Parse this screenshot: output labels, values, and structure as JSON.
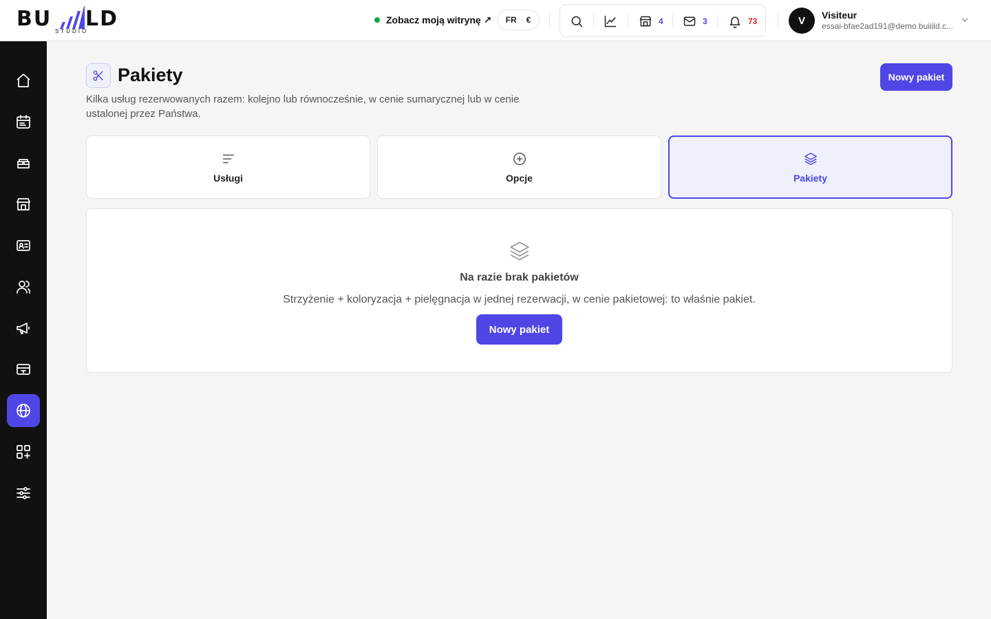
{
  "brand": {
    "logo_left": "BU",
    "logo_right": "LD",
    "logo_sub": "STUDIO",
    "accent": "#4f46e5"
  },
  "topbar": {
    "site_link": "Zobacz moją witrynę ↗",
    "site_status_color": "#16a34a",
    "lang": "FR",
    "currency": "€",
    "tools": [
      {
        "icon": "search-icon"
      },
      {
        "icon": "chart-line-icon"
      },
      {
        "icon": "store-icon",
        "count": "4",
        "color": "#4f46e5"
      },
      {
        "icon": "mail-icon",
        "count": "3",
        "color": "#4f46e5"
      },
      {
        "icon": "bell-icon",
        "count": "73",
        "color": "#dc2626"
      }
    ],
    "user": {
      "initial": "V",
      "name": "Visiteur",
      "email": "essai-bfae2ad191@demo.buiiild.c..."
    }
  },
  "sidebar": {
    "items": [
      {
        "icon": "home-icon"
      },
      {
        "icon": "calendar-icon"
      },
      {
        "icon": "scissors-case-icon"
      },
      {
        "icon": "store-icon"
      },
      {
        "icon": "contact-card-icon"
      },
      {
        "icon": "users-icon"
      },
      {
        "icon": "megaphone-icon"
      },
      {
        "icon": "payment-card-icon"
      },
      {
        "icon": "globe-icon",
        "active": true
      },
      {
        "icon": "apps-add-icon"
      },
      {
        "icon": "sliders-icon"
      }
    ]
  },
  "page": {
    "title": "Pakiety",
    "title_icon": "scissors-icon",
    "description": "Kilka usług rezerwowanych razem: kolejno lub równocześnie, w cenie sumarycznej lub w cenie ustalonej przez Państwa.",
    "new_button": "Nowy pakiet",
    "tabs": [
      {
        "label": "Usługi",
        "icon": "list-icon",
        "active": false
      },
      {
        "label": "Opcje",
        "icon": "plus-circle-icon",
        "active": false
      },
      {
        "label": "Pakiety",
        "icon": "layers-icon",
        "active": true
      }
    ],
    "empty": {
      "icon": "layers-icon",
      "title": "Na razie brak pakietów",
      "text": "Strzyżenie + koloryzacja + pielęgnacja w jednej rezerwacji, w cenie pakietowej: to właśnie pakiet.",
      "button": "Nowy pakiet"
    }
  }
}
